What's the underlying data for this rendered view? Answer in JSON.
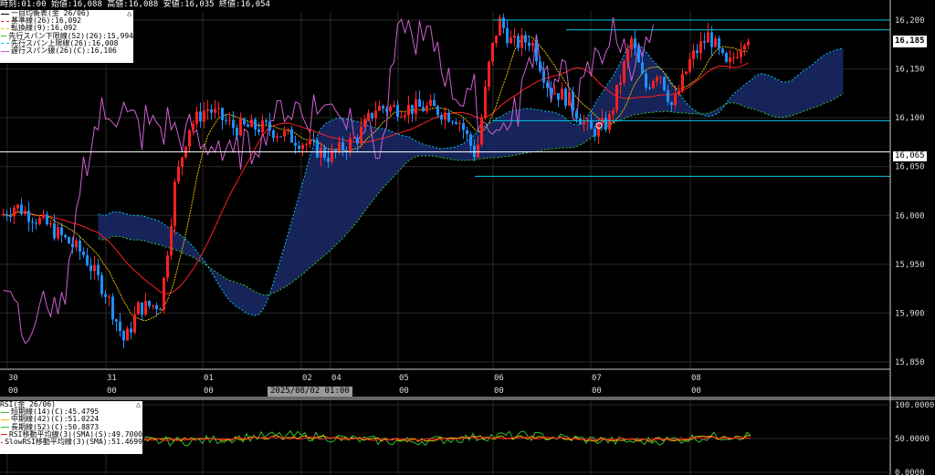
{
  "header": {
    "time_label": "時刻:01:00",
    "open_label": "始値:16,088",
    "high_label": "高値:16,088",
    "low_label": "安値:16,035",
    "close_label": "終値:16,054"
  },
  "legend": {
    "title": "一目均衡表(金 26/06)",
    "items": [
      {
        "label": "基準線(26):16,092",
        "color": "#ff2020"
      },
      {
        "label": "転換線(9):16,092",
        "color": "#e8c000"
      },
      {
        "label": "先行スパン下限線(52)(26):15,994",
        "color": "#30c030"
      },
      {
        "label": "先行スパン上限線(26):16,008",
        "color": "#00c8e8"
      },
      {
        "label": "遅行スパン線(26)(C):16,106",
        "color": "#d060d0"
      }
    ]
  },
  "price_axis": {
    "ticks": [
      "16,200",
      "16,150",
      "16,100",
      "16,050",
      "16,000",
      "15,950",
      "15,900",
      "15,850"
    ],
    "current_price": "16,185",
    "cursor_price": "16,065"
  },
  "time_axis": {
    "ticks": [
      {
        "day": "30",
        "hour": "00"
      },
      {
        "day": "31",
        "hour": "00"
      },
      {
        "day": "01",
        "hour": "00"
      },
      {
        "day": "02",
        "hour": ""
      },
      {
        "day": "04",
        "hour": ""
      },
      {
        "day": "05",
        "hour": "00"
      },
      {
        "day": "06",
        "hour": "00"
      },
      {
        "day": "07",
        "hour": "00"
      },
      {
        "day": "08",
        "hour": "00"
      }
    ],
    "cursor_date": "2025/08/02 01:00"
  },
  "rsi": {
    "title": "RSI(金 26/06)",
    "items": [
      {
        "label": "短期線(14)(C):45.4795",
        "color": "#30c030"
      },
      {
        "label": "中期線(42)(C):51.0224",
        "color": "#e8c000"
      },
      {
        "label": "長期線(52)(C):50.8873",
        "color": "#30c030"
      },
      {
        "label": "RSI移動平均線(3)(SMA)(S):49.7000",
        "color": "#ff2020"
      },
      {
        "label": "SlowRSI移動平均線(3)(SMA):51.4699",
        "color": "#ff2020"
      }
    ],
    "ticks": [
      "100.0000",
      "50.0000",
      "0.0000"
    ]
  },
  "colors": {
    "up": "#ff2020",
    "down": "#1e90ff",
    "cloud": "#1a2a6a",
    "cyan": "#00c8e8",
    "grid": "#2a2a2a"
  }
}
